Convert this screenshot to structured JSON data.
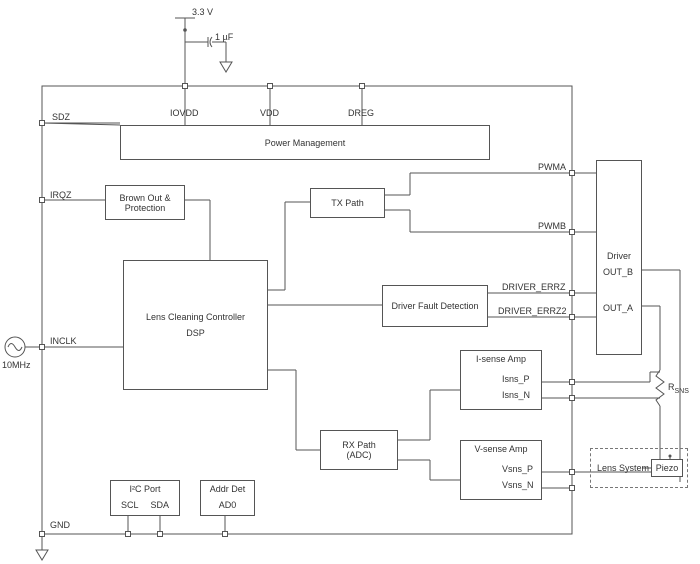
{
  "supply": {
    "voltage": "3.3 V",
    "cap": "1 µF"
  },
  "top_pins": {
    "iovdd": "IOVDD",
    "vdd": "VDD",
    "dreg": "DREG"
  },
  "left_pins": {
    "sdz": "SDZ",
    "irqz": "IRQZ",
    "inclk": "INCLK",
    "gnd": "GND"
  },
  "clock": "10MHz",
  "blocks": {
    "power": "Power Management",
    "brownout_l1": "Brown Out &",
    "brownout_l2": "Protection",
    "tx": "TX Path",
    "dsp_l1": "Lens Cleaning Controller",
    "dsp_l2": "DSP",
    "fault": "Driver Fault Detection",
    "rx_l1": "RX Path",
    "rx_l2": "(ADC)",
    "isense": "I-sense Amp",
    "isns_p": "Isns_P",
    "isns_n": "Isns_N",
    "vsense": "V-sense Amp",
    "vsns_p": "Vsns_P",
    "vsns_n": "Vsns_N",
    "i2c_title": "I²C Port",
    "i2c_scl": "SCL",
    "i2c_sda": "SDA",
    "addr_title": "Addr Det",
    "addr_ad0": "AD0",
    "driver": "Driver",
    "out_b": "OUT_B",
    "out_a": "OUT_A"
  },
  "right_pins": {
    "pwma": "PWMA",
    "pwmb": "PWMB",
    "derrz": "DRIVER_ERRZ",
    "derrz2": "DRIVER_ERRZ2"
  },
  "rsns": "R",
  "rsns_sub": "SNS",
  "lens": "Lens System",
  "piezo": "Piezo"
}
